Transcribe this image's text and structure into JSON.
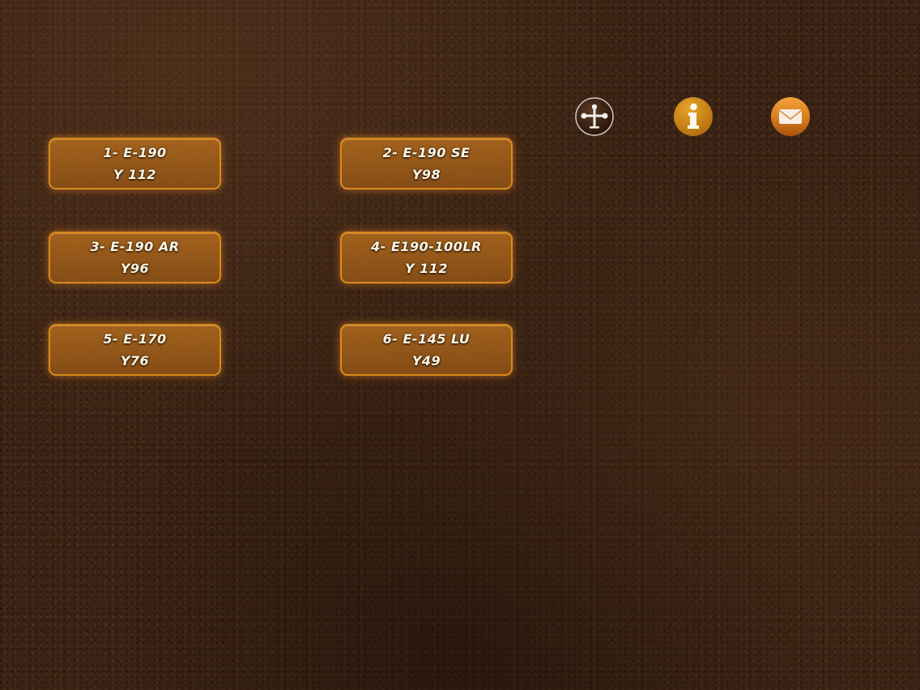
{
  "toolbar": {
    "icons": [
      "windsock-icon",
      "info-icon",
      "mail-icon"
    ],
    "colors": {
      "icon_gold": "#c98512",
      "icon_mail": "#d0781a"
    }
  },
  "menu": {
    "accent_color": "#d98a1b",
    "items": [
      {
        "line1": "1- E-190",
        "line2": "Y 112"
      },
      {
        "line1": "2- E-190 SE",
        "line2": "Y98"
      },
      {
        "line1": "3- E-190 AR",
        "line2": "Y96"
      },
      {
        "line1": "4- E190-100LR",
        "line2": "Y 112"
      },
      {
        "line1": "5- E-170",
        "line2": "Y76"
      },
      {
        "line1": "6- E-145 LU",
        "line2": "Y49"
      }
    ]
  }
}
